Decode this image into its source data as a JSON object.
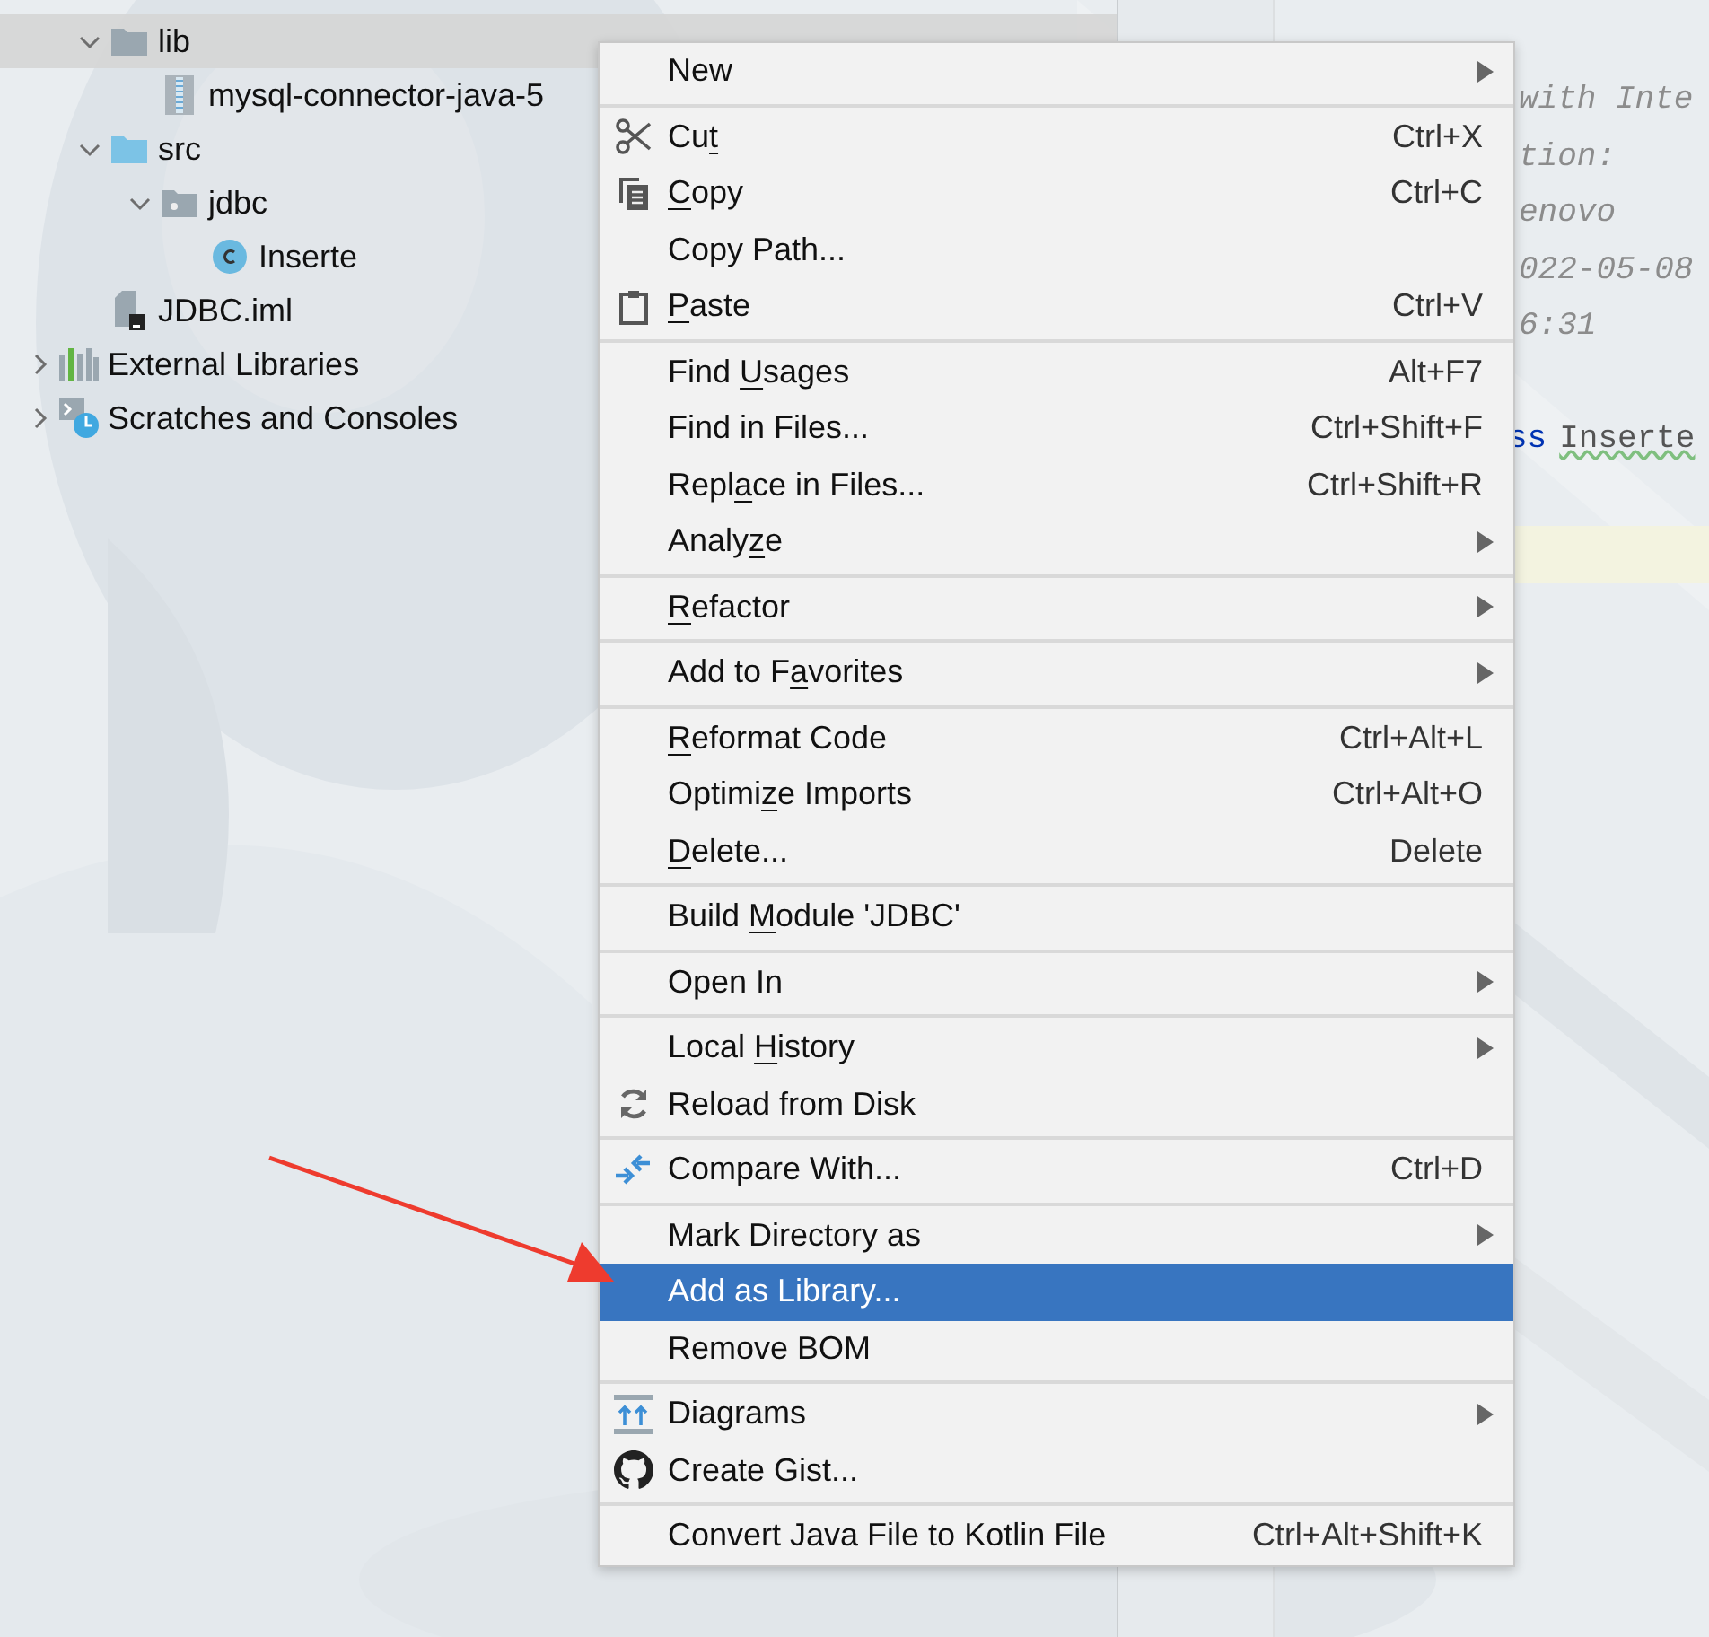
{
  "project_tree": {
    "items": [
      {
        "label": "lib",
        "kind": "folder",
        "expanded": true,
        "selected": true,
        "children": [
          {
            "label": "mysql-connector-java-5",
            "kind": "jar",
            "selected": false
          }
        ]
      },
      {
        "label": "src",
        "kind": "source-folder",
        "expanded": true,
        "selected": false,
        "children": [
          {
            "label": "jdbc",
            "kind": "package",
            "expanded": true,
            "selected": false,
            "children": [
              {
                "label": "Inserte",
                "kind": "class",
                "selected": false
              }
            ]
          }
        ]
      },
      {
        "label": "JDBC.iml",
        "kind": "module-file",
        "selected": false
      }
    ],
    "root_items": [
      {
        "label": "External Libraries",
        "kind": "libraries",
        "expanded": false,
        "selected": false
      },
      {
        "label": "Scratches and Consoles",
        "kind": "scratches",
        "expanded": false,
        "selected": false
      }
    ]
  },
  "editor": {
    "lines": [
      {
        "kind": "comment",
        "text": "with Inte"
      },
      {
        "kind": "comment",
        "text": "tion:"
      },
      {
        "kind": "comment",
        "text": "enovo"
      },
      {
        "kind": "comment",
        "text": "022-05-08"
      },
      {
        "kind": "comment",
        "text": "6:31"
      },
      {
        "kind": "blank"
      },
      {
        "kind": "declaration",
        "keyword": "ss",
        "name": "Inserte"
      },
      {
        "kind": "blank"
      },
      {
        "kind": "current-line"
      }
    ]
  },
  "context_menu": {
    "groups": [
      {
        "items": [
          {
            "label_parts": [
              {
                "text": "New",
                "underlined": false
              }
            ],
            "submenu": true,
            "selected": false
          }
        ]
      },
      {
        "items": [
          {
            "label_parts": [
              {
                "text": "Cu",
                "underlined": false
              },
              {
                "text": "t",
                "underlined": true
              }
            ],
            "shortcut": "Ctrl+X",
            "submenu": false,
            "selected": false
          },
          {
            "label_parts": [
              {
                "text": "C",
                "underlined": true
              },
              {
                "text": "opy",
                "underlined": false
              }
            ],
            "shortcut": "Ctrl+C",
            "submenu": false,
            "selected": false
          },
          {
            "label_parts": [
              {
                "text": "Copy Path...",
                "underlined": false
              }
            ],
            "submenu": false,
            "selected": false
          },
          {
            "label_parts": [
              {
                "text": "P",
                "underlined": true
              },
              {
                "text": "aste",
                "underlined": false
              }
            ],
            "shortcut": "Ctrl+V",
            "submenu": false,
            "selected": false
          }
        ]
      },
      {
        "items": [
          {
            "label_parts": [
              {
                "text": "Find ",
                "underlined": false
              },
              {
                "text": "U",
                "underlined": true
              },
              {
                "text": "sages",
                "underlined": false
              }
            ],
            "shortcut": "Alt+F7",
            "submenu": false,
            "selected": false
          },
          {
            "label_parts": [
              {
                "text": "Find in Files...",
                "underlined": false
              }
            ],
            "shortcut": "Ctrl+Shift+F",
            "submenu": false,
            "selected": false
          },
          {
            "label_parts": [
              {
                "text": "Repl",
                "underlined": false
              },
              {
                "text": "a",
                "underlined": true
              },
              {
                "text": "ce in Files...",
                "underlined": false
              }
            ],
            "shortcut": "Ctrl+Shift+R",
            "submenu": false,
            "selected": false
          },
          {
            "label_parts": [
              {
                "text": "Analy",
                "underlined": false
              },
              {
                "text": "z",
                "underlined": true
              },
              {
                "text": "e",
                "underlined": false
              }
            ],
            "submenu": true,
            "selected": false
          }
        ]
      },
      {
        "items": [
          {
            "label_parts": [
              {
                "text": "R",
                "underlined": true
              },
              {
                "text": "efactor",
                "underlined": false
              }
            ],
            "submenu": true,
            "selected": false
          }
        ]
      },
      {
        "items": [
          {
            "label_parts": [
              {
                "text": "Add to F",
                "underlined": false
              },
              {
                "text": "a",
                "underlined": true
              },
              {
                "text": "vorites",
                "underlined": false
              }
            ],
            "submenu": true,
            "selected": false
          }
        ]
      },
      {
        "items": [
          {
            "label_parts": [
              {
                "text": "R",
                "underlined": true
              },
              {
                "text": "eformat Code",
                "underlined": false
              }
            ],
            "shortcut": "Ctrl+Alt+L",
            "submenu": false,
            "selected": false
          },
          {
            "label_parts": [
              {
                "text": "Optimi",
                "underlined": false
              },
              {
                "text": "z",
                "underlined": true
              },
              {
                "text": "e Imports",
                "underlined": false
              }
            ],
            "shortcut": "Ctrl+Alt+O",
            "submenu": false,
            "selected": false
          },
          {
            "label_parts": [
              {
                "text": "D",
                "underlined": true
              },
              {
                "text": "elete...",
                "underlined": false
              }
            ],
            "shortcut": "Delete",
            "submenu": false,
            "selected": false
          }
        ]
      },
      {
        "items": [
          {
            "label_parts": [
              {
                "text": "Build ",
                "underlined": false
              },
              {
                "text": "M",
                "underlined": true
              },
              {
                "text": "odule 'JDBC'",
                "underlined": false
              }
            ],
            "submenu": false,
            "selected": false
          }
        ]
      },
      {
        "items": [
          {
            "label_parts": [
              {
                "text": "Open In",
                "underlined": false
              }
            ],
            "submenu": true,
            "selected": false
          }
        ]
      },
      {
        "items": [
          {
            "label_parts": [
              {
                "text": "Local ",
                "underlined": false
              },
              {
                "text": "H",
                "underlined": true
              },
              {
                "text": "istory",
                "underlined": false
              }
            ],
            "submenu": true,
            "selected": false
          },
          {
            "label_parts": [
              {
                "text": "Reload from Disk",
                "underlined": false
              }
            ],
            "submenu": false,
            "selected": false
          }
        ]
      },
      {
        "items": [
          {
            "label_parts": [
              {
                "text": "Compare With...",
                "underlined": false
              }
            ],
            "shortcut": "Ctrl+D",
            "submenu": false,
            "selected": false
          }
        ]
      },
      {
        "items": [
          {
            "label_parts": [
              {
                "text": "Mark Directory as",
                "underlined": false
              }
            ],
            "submenu": true,
            "selected": false
          },
          {
            "label_parts": [
              {
                "text": "Add as Library...",
                "underlined": false
              }
            ],
            "submenu": false,
            "selected": true
          },
          {
            "label_parts": [
              {
                "text": "Remove BOM",
                "underlined": false
              }
            ],
            "submenu": false,
            "selected": false
          }
        ]
      },
      {
        "items": [
          {
            "label_parts": [
              {
                "text": "Diagrams",
                "underlined": false
              }
            ],
            "submenu": true,
            "selected": false
          },
          {
            "label_parts": [
              {
                "text": "Create Gist...",
                "underlined": false
              }
            ],
            "submenu": false,
            "selected": false
          }
        ]
      },
      {
        "items": [
          {
            "label_parts": [
              {
                "text": "Convert Java File to Kotlin File",
                "underlined": false
              }
            ],
            "shortcut": "Ctrl+Alt+Shift+K",
            "submenu": false,
            "selected": false
          }
        ]
      }
    ]
  }
}
